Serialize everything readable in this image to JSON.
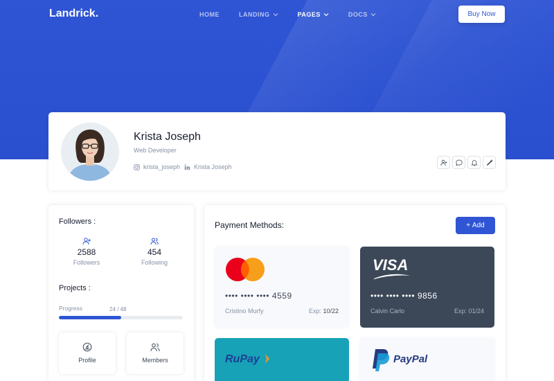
{
  "header": {
    "logo": "Landrick.",
    "menu": [
      {
        "label": "HOME",
        "has_dropdown": false,
        "active": false
      },
      {
        "label": "LANDING",
        "has_dropdown": true,
        "active": false
      },
      {
        "label": "PAGES",
        "has_dropdown": true,
        "active": true
      },
      {
        "label": "DOCS",
        "has_dropdown": true,
        "active": false
      }
    ],
    "buy_button": "Buy Now"
  },
  "profile": {
    "name": "Krista Joseph",
    "role": "Web Developer",
    "instagram": "krista_joseph",
    "linkedin": "Krista Joseph",
    "actions": [
      "add-user-icon",
      "message-icon",
      "bell-icon",
      "tools-icon"
    ]
  },
  "followers": {
    "title": "Followers :",
    "followers_count": "2588",
    "followers_label": "Followers",
    "following_count": "454",
    "following_label": "Following"
  },
  "projects": {
    "title": "Projects :",
    "progress_label": "Progress",
    "progress_value": "24 / 48",
    "progress_fraction": 0.5,
    "tiles": [
      {
        "label": "Profile",
        "icon": "dashboard-icon"
      },
      {
        "label": "Members",
        "icon": "users-icon"
      }
    ]
  },
  "payment": {
    "title": "Payment Methods:",
    "add_button": "Add",
    "cards": [
      {
        "brand": "mastercard",
        "number": "•••• •••• •••• 4559",
        "holder": "Cristino Murfy",
        "exp_label": "Exp:",
        "exp": "10/22"
      },
      {
        "brand": "VISA",
        "number": "•••• •••• •••• 9856",
        "holder": "Calvin Carlo",
        "exp_label": "Exp:",
        "exp": "01/24"
      }
    ],
    "more_brands": [
      "RuPay",
      "PayPal"
    ]
  },
  "colors": {
    "primary": "#2f55d4",
    "dark_card": "#3c4858",
    "rupay": "#17a2b8"
  }
}
